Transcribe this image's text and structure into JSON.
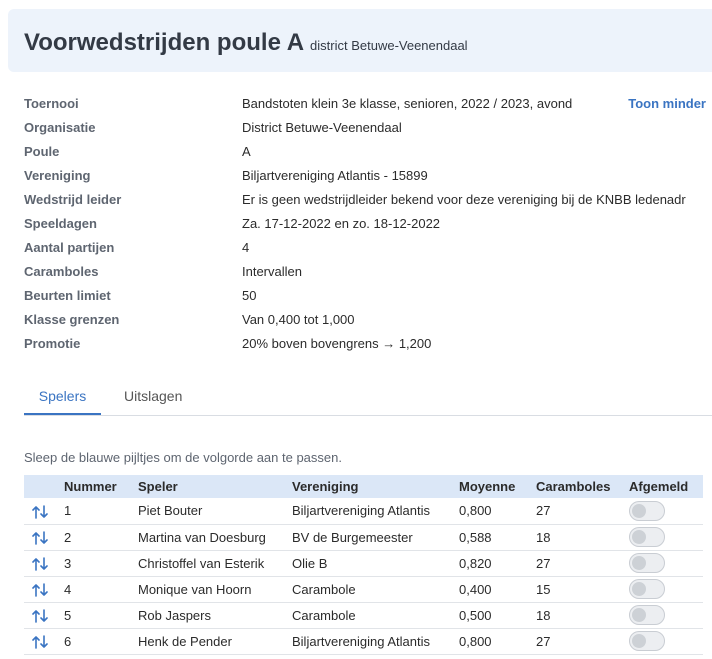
{
  "header": {
    "title": "Voorwedstrijden poule A",
    "subtitle": "district Betuwe-Veenendaal"
  },
  "info": {
    "toggle_label": "Toon minder",
    "rows": [
      {
        "label": "Toernooi",
        "value": "Bandstoten klein 3e klasse, senioren, 2022 / 2023, avond"
      },
      {
        "label": "Organisatie",
        "value": "District Betuwe-Veenendaal"
      },
      {
        "label": "Poule",
        "value": "A"
      },
      {
        "label": "Vereniging",
        "value": "Biljartvereniging Atlantis - 15899"
      },
      {
        "label": "Wedstrijd leider",
        "value": "Er is geen wedstrijdleider bekend voor deze vereniging bij de KNBB ledenadr"
      },
      {
        "label": "Speeldagen",
        "value": "Za. 17-12-2022 en zo. 18-12-2022"
      },
      {
        "label": "Aantal partijen",
        "value": "4"
      },
      {
        "label": "Caramboles",
        "value": "Intervallen"
      },
      {
        "label": "Beurten limiet",
        "value": "50"
      },
      {
        "label": "Klasse grenzen",
        "value": "Van 0,400 tot 1,000"
      },
      {
        "label": "Promotie",
        "value": "20% boven bovengrens → 1,200"
      }
    ]
  },
  "tabs": [
    {
      "label": "Spelers",
      "active": true
    },
    {
      "label": "Uitslagen",
      "active": false
    }
  ],
  "hint": "Sleep de blauwe pijltjes om de volgorde aan te passen.",
  "table": {
    "headers": [
      "",
      "Nummer",
      "Speler",
      "Vereniging",
      "Moyenne",
      "Caramboles",
      "Afgemeld"
    ],
    "rows": [
      {
        "nummer": "1",
        "speler": "Piet Bouter",
        "vereniging": "Biljartvereniging Atlantis",
        "moyenne": "0,800",
        "caramboles": "27",
        "afgemeld": false
      },
      {
        "nummer": "2",
        "speler": "Martina van Doesburg",
        "vereniging": "BV de Burgemeester",
        "moyenne": "0,588",
        "caramboles": "18",
        "afgemeld": false
      },
      {
        "nummer": "3",
        "speler": "Christoffel van Esterik",
        "vereniging": "Olie B",
        "moyenne": "0,820",
        "caramboles": "27",
        "afgemeld": false
      },
      {
        "nummer": "4",
        "speler": "Monique van Hoorn",
        "vereniging": "Carambole",
        "moyenne": "0,400",
        "caramboles": "15",
        "afgemeld": false
      },
      {
        "nummer": "5",
        "speler": "Rob Jaspers",
        "vereniging": "Carambole",
        "moyenne": "0,500",
        "caramboles": "18",
        "afgemeld": false
      },
      {
        "nummer": "6",
        "speler": "Henk de Pender",
        "vereniging": "Biljartvereniging Atlantis",
        "moyenne": "0,800",
        "caramboles": "27",
        "afgemeld": false
      }
    ]
  },
  "icons": {
    "drag": "sort-arrows-icon"
  },
  "colors": {
    "accent": "#3a74c2",
    "header_bg": "#edf3fb",
    "table_header_bg": "#dbe7f7"
  }
}
